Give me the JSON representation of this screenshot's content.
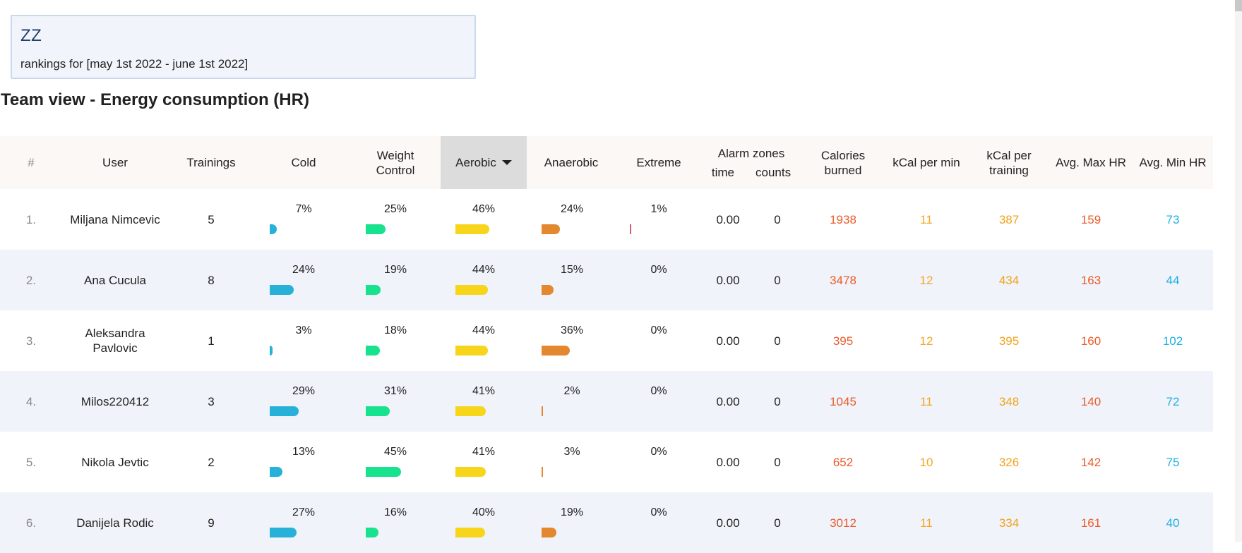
{
  "info": {
    "title": "ZZ",
    "subtitle": "rankings for [may 1st 2022 - june 1st 2022]"
  },
  "heading": "Team view - Energy consumption (HR)",
  "columns": {
    "rank": "#",
    "user": "User",
    "trainings": "Trainings",
    "cold": "Cold",
    "weight": "Weight Control",
    "aerobic": "Aerobic",
    "anaerobic": "Anaerobic",
    "extreme": "Extreme",
    "alarm": "Alarm zones",
    "alarm_time": "time",
    "alarm_counts": "counts",
    "calories": "Calories burned",
    "kcal_min": "kCal per min",
    "kcal_training": "kCal per training",
    "avg_max_hr": "Avg. Max HR",
    "avg_min_hr": "Avg. Min HR"
  },
  "colors": {
    "cold": "#27b0d8",
    "weight": "#17e28e",
    "aerobic": "#f7d51a",
    "anaerobic": "#e3882e",
    "extreme": "#d45c73"
  },
  "rows": [
    {
      "rank": "1.",
      "user": "Miljana Nimcevic",
      "trainings": "5",
      "cold": "7%",
      "weight": "25%",
      "aerobic": "46%",
      "anaerobic": "24%",
      "extreme": "1%",
      "time": "0.00",
      "counts": "0",
      "calories": "1938",
      "kcal_min": "11",
      "kcal_training": "387",
      "max_hr": "159",
      "min_hr": "73"
    },
    {
      "rank": "2.",
      "user": "Ana Cucula",
      "trainings": "8",
      "cold": "24%",
      "weight": "19%",
      "aerobic": "44%",
      "anaerobic": "15%",
      "extreme": "0%",
      "time": "0.00",
      "counts": "0",
      "calories": "3478",
      "kcal_min": "12",
      "kcal_training": "434",
      "max_hr": "163",
      "min_hr": "44"
    },
    {
      "rank": "3.",
      "user": "Aleksandra Pavlovic",
      "trainings": "1",
      "cold": "3%",
      "weight": "18%",
      "aerobic": "44%",
      "anaerobic": "36%",
      "extreme": "0%",
      "time": "0.00",
      "counts": "0",
      "calories": "395",
      "kcal_min": "12",
      "kcal_training": "395",
      "max_hr": "160",
      "min_hr": "102"
    },
    {
      "rank": "4.",
      "user": "Milos220412",
      "trainings": "3",
      "cold": "29%",
      "weight": "31%",
      "aerobic": "41%",
      "anaerobic": "2%",
      "extreme": "0%",
      "time": "0.00",
      "counts": "0",
      "calories": "1045",
      "kcal_min": "11",
      "kcal_training": "348",
      "max_hr": "140",
      "min_hr": "72"
    },
    {
      "rank": "5.",
      "user": "Nikola Jevtic",
      "trainings": "2",
      "cold": "13%",
      "weight": "45%",
      "aerobic": "41%",
      "anaerobic": "3%",
      "extreme": "0%",
      "time": "0.00",
      "counts": "0",
      "calories": "652",
      "kcal_min": "10",
      "kcal_training": "326",
      "max_hr": "142",
      "min_hr": "75"
    },
    {
      "rank": "6.",
      "user": "Danijela Rodic",
      "trainings": "9",
      "cold": "27%",
      "weight": "16%",
      "aerobic": "40%",
      "anaerobic": "19%",
      "extreme": "0%",
      "time": "0.00",
      "counts": "0",
      "calories": "3012",
      "kcal_min": "11",
      "kcal_training": "334",
      "max_hr": "161",
      "min_hr": "40"
    }
  ]
}
